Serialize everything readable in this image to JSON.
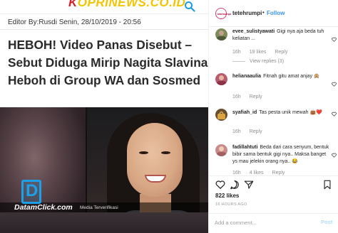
{
  "article": {
    "site_logo_first_letter": "K",
    "site_logo_rest": "OPRINEWS.CO.ID",
    "editor_line": "Editor By:Rusdi Senin, 28/10/2019 - 20:56",
    "headline": "HEBOH! Video Panas Disebut – Sebut Diduga Mirip Nagita Slavina Heboh di Group WA dan Sosmed",
    "watermark_letter": "D",
    "watermark_brand": "DatamClick.com",
    "watermark_tagline": "Media Terverifikasi"
  },
  "post": {
    "owner_avatar_text": "tetehrumpi",
    "owner_username": "tetehrumpi",
    "separator": "•",
    "follow_label": "Follow",
    "comments": [
      {
        "username": "evee_sulistyawati",
        "text": "Gigi nya aja beda tuh keliatan ...",
        "age": "16h",
        "likes": "19 likes",
        "reply": "Reply",
        "view_replies": "View replies (3)",
        "avatar_color": "#7d8a5a"
      },
      {
        "username": "helianaaulia",
        "text": "Fitnah gitu amat anjay 🙊",
        "age": "16h",
        "likes": "",
        "reply": "Reply",
        "avatar_color": "#b75d6e"
      },
      {
        "username": "syafiah_id",
        "text": "Tas pesta unik mewah 👜❤️",
        "age": "16h",
        "likes": "",
        "reply": "Reply",
        "avatar_color": "#6b4f2c"
      },
      {
        "username": "fadillahtuti",
        "text": "Beda dari cara senyum, bentuk bibir sama bentuk gigi nya.. Maksa banget ys mau jelekin orang nya.. 😂",
        "age": "16h",
        "likes": "4 likes",
        "reply": "Reply",
        "avatar_color": "#c98a8a"
      }
    ],
    "likes_count": "822 likes",
    "time_ago": "16 HOURS AGO",
    "add_comment_placeholder": "Add a comment...",
    "post_label": "Post"
  },
  "colors": {
    "link_blue": "#3897f0",
    "post_disabled": "#b3dbff",
    "logo_yellow": "#f3c400",
    "logo_red": "#d6202a",
    "datamclick_blue": "#1ea0e8"
  },
  "icons": {
    "article_search": "search-icon",
    "like": "heart-icon",
    "comment": "comment-bubble-icon",
    "share": "paper-plane-icon",
    "save": "bookmark-icon",
    "comment_like": "small-heart-icon"
  }
}
